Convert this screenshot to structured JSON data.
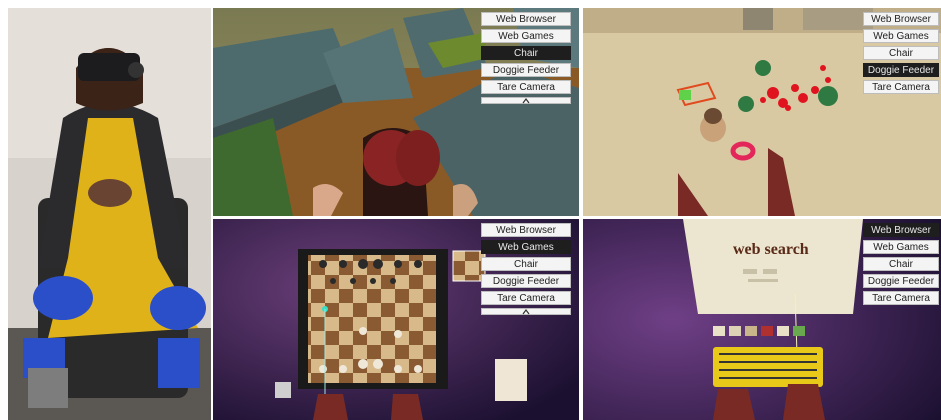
{
  "menu_items": [
    "Web Browser",
    "Web Games",
    "Chair",
    "Doggie Feeder",
    "Tare Camera"
  ],
  "panels": {
    "maze": {
      "selected": "Chair"
    },
    "dog": {
      "selected": "Doggie Feeder"
    },
    "chess": {
      "selected": "Web Games"
    },
    "web": {
      "selected": "Web Browser",
      "page_title": "web search"
    }
  },
  "colors": {
    "selected_bg": "#1e1e1e",
    "item_bg": "#f4f4f4",
    "sky_purple": "#3a1f5c",
    "sand": "#d9c9a3"
  },
  "icons": [
    "chevron-up-icon"
  ]
}
